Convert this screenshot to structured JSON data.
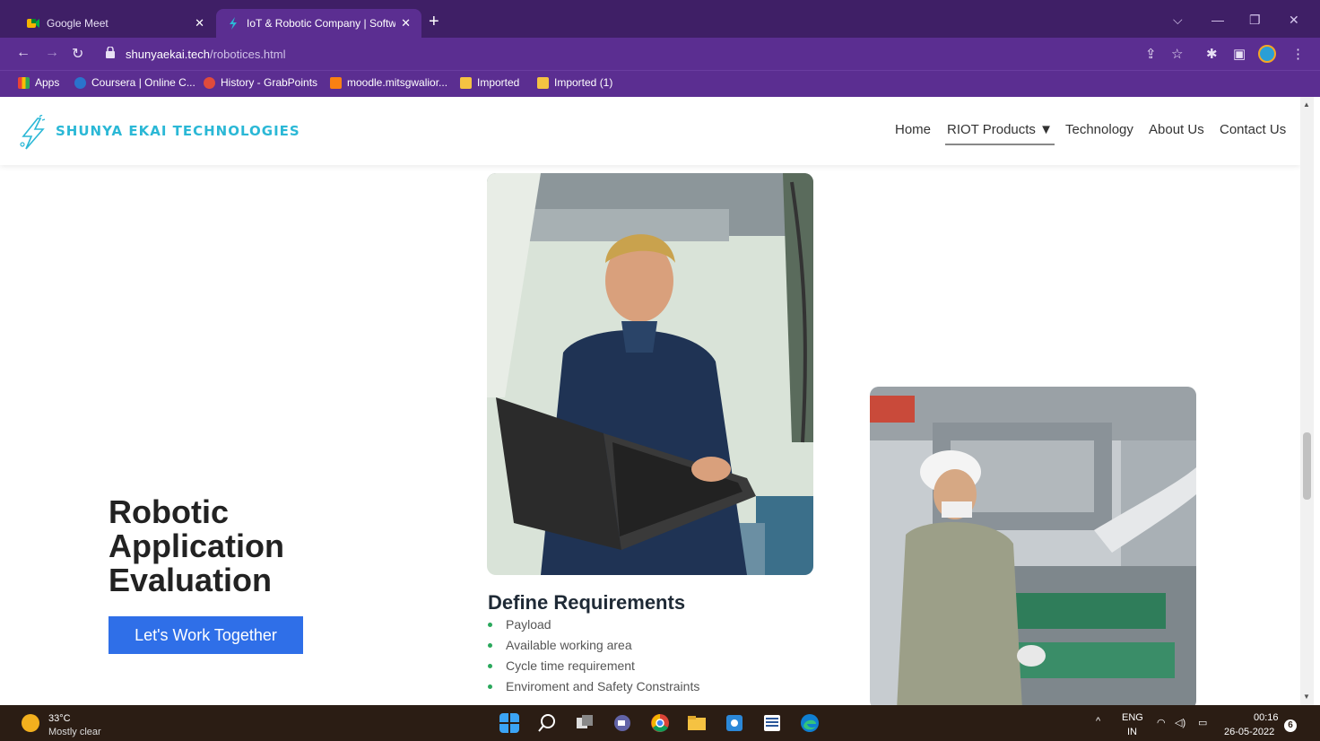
{
  "browser": {
    "tabs": [
      {
        "title": "Google Meet",
        "active": false
      },
      {
        "title": "IoT & Robotic Company | Softwa",
        "active": true
      }
    ],
    "new_tab_icon": "plus-icon",
    "address": {
      "host": "shunyaekai.tech",
      "path": "/robotices.html"
    },
    "bookmarks": [
      {
        "label": "Apps",
        "icon": "apps-grid-icon"
      },
      {
        "label": "Coursera | Online C...",
        "icon": "coursera-icon"
      },
      {
        "label": "History - GrabPoints",
        "icon": "grabpoints-icon"
      },
      {
        "label": "moodle.mitsgwalior...",
        "icon": "moodle-icon"
      },
      {
        "label": "Imported",
        "icon": "folder-icon"
      },
      {
        "label": "Imported (1)",
        "icon": "folder-icon"
      }
    ]
  },
  "site": {
    "logo_text": "SHUNYA EKAI TECHNOLOGIES",
    "nav": [
      {
        "label": "Home"
      },
      {
        "label": "RIOT Products ▼"
      },
      {
        "label": "Technology"
      },
      {
        "label": "About Us"
      },
      {
        "label": "Contact Us"
      }
    ],
    "hero_title_lines": [
      "Robotic",
      "Application",
      "Evaluation"
    ],
    "cta_label": "Let's Work Together",
    "section_title": "Define Requirements",
    "requirements": [
      "Payload",
      "Available working area",
      "Cycle time requirement",
      "Enviroment and Safety Constraints"
    ]
  },
  "taskbar": {
    "weather_temp": "33°C",
    "weather_condition": "Mostly clear",
    "language_line1": "ENG",
    "language_line2": "IN",
    "time": "00:16",
    "date": "26-05-2022",
    "notification_count": "6"
  },
  "colors": {
    "chrome_frame": "#3f1f66",
    "chrome_toolbar": "#5b2e91",
    "logo": "#2bb8d6",
    "cta": "#2f6fe8",
    "bullet": "#2aa85c",
    "taskbar": "#2b1d14"
  }
}
